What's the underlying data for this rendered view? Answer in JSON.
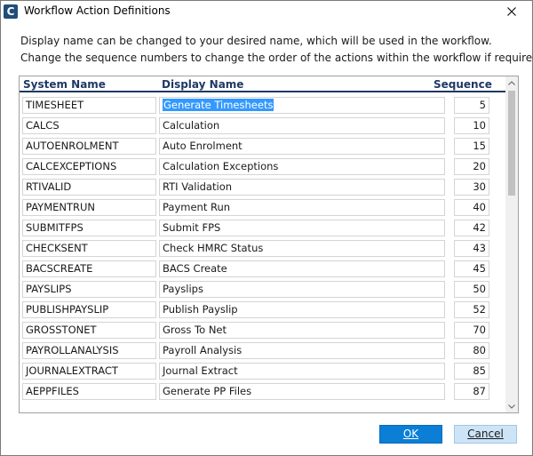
{
  "window": {
    "title": "Workflow Action Definitions"
  },
  "instructions": {
    "line1": "Display name can be changed to your desired name, which will be used in the workflow.",
    "line2": "Change the sequence numbers to change the order of the actions within the workflow if required."
  },
  "table": {
    "headers": {
      "system_name": "System Name",
      "display_name": "Display Name",
      "sequence": "Sequence"
    },
    "rows": [
      {
        "system": "TIMESHEET",
        "display": "Generate Timesheets",
        "sequence": "5",
        "selected": true
      },
      {
        "system": "CALCS",
        "display": "Calculation",
        "sequence": "10"
      },
      {
        "system": "AUTOENROLMENT",
        "display": "Auto Enrolment",
        "sequence": "15"
      },
      {
        "system": "CALCEXCEPTIONS",
        "display": "Calculation Exceptions",
        "sequence": "20"
      },
      {
        "system": "RTIVALID",
        "display": "RTI Validation",
        "sequence": "30"
      },
      {
        "system": "PAYMENTRUN",
        "display": "Payment Run",
        "sequence": "40"
      },
      {
        "system": "SUBMITFPS",
        "display": "Submit FPS",
        "sequence": "42"
      },
      {
        "system": "CHECKSENT",
        "display": "Check HMRC Status",
        "sequence": "43"
      },
      {
        "system": "BACSCREATE",
        "display": "BACS Create",
        "sequence": "45"
      },
      {
        "system": "PAYSLIPS",
        "display": "Payslips",
        "sequence": "50"
      },
      {
        "system": "PUBLISHPAYSLIP",
        "display": "Publish Payslip",
        "sequence": "52"
      },
      {
        "system": "GROSSTONET",
        "display": "Gross To Net",
        "sequence": "70"
      },
      {
        "system": "PAYROLLANALYSIS",
        "display": "Payroll Analysis",
        "sequence": "80"
      },
      {
        "system": "JOURNALEXTRACT",
        "display": "Journal Extract",
        "sequence": "85"
      },
      {
        "system": "AEPPFILES",
        "display": "Generate PP Files",
        "sequence": "87"
      }
    ]
  },
  "buttons": {
    "ok": "OK",
    "cancel": "Cancel"
  },
  "icons": {
    "app": "app-logo-icon",
    "close": "close-icon",
    "scroll_up": "chevron-up-icon",
    "scroll_down": "chevron-down-icon"
  },
  "colors": {
    "header_text": "#1f3864",
    "selection": "#3399ff",
    "ok_button": "#0b7ed6",
    "cancel_button": "#cde4f7"
  }
}
